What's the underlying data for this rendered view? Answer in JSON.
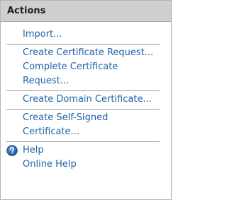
{
  "panel": {
    "title": "Actions",
    "items": [
      {
        "label": "Import..."
      },
      {
        "label": "Create Certificate Request..."
      },
      {
        "label": "Complete Certificate"
      },
      {
        "label": "Request..."
      },
      {
        "label": "Create Domain Certificate..."
      },
      {
        "label": "Create Self-Signed"
      },
      {
        "label": "Certificate..."
      },
      {
        "label": "Help",
        "icon": "help-icon"
      },
      {
        "label": "Online Help"
      }
    ]
  },
  "colors": {
    "link": "#1f63a8",
    "header_bg": "#cfcfcf",
    "separator": "#9c9c9c",
    "help_icon": "#2b5ba8"
  }
}
